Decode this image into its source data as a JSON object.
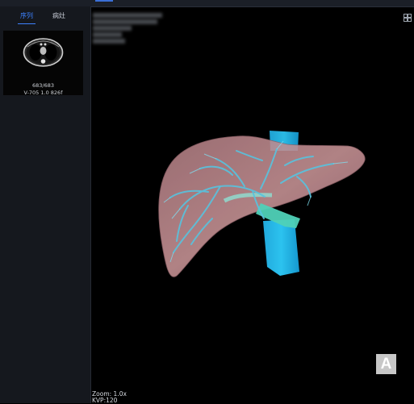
{
  "sidebar": {
    "tabs": [
      {
        "label": "序列",
        "active": true
      },
      {
        "label": "病灶",
        "active": false
      }
    ],
    "series": {
      "count": "683/683",
      "meta": "V-705  1.0  826f"
    }
  },
  "viewport": {
    "zoom": "Zoom: 1.0x",
    "kvp": "KVP:120",
    "orientation": "A",
    "layout_icon": "grid-icon"
  },
  "colors": {
    "accent": "#3d82ff",
    "liver": "#c48e90",
    "vessels": "#47c9e0",
    "vena_cava": "#19b8e6"
  }
}
